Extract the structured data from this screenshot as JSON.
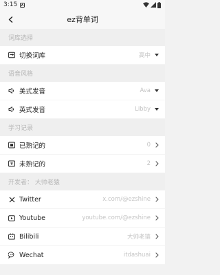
{
  "status_bar": {
    "time": "3:15"
  },
  "header": {
    "title": "ez背单词"
  },
  "sections": {
    "library": {
      "title": "词库选择",
      "switch": {
        "label": "切换词库",
        "value": "高中"
      }
    },
    "voice": {
      "title": "语音风格",
      "us": {
        "label": "美式发音",
        "value": "Ava"
      },
      "uk": {
        "label": "英式发音",
        "value": "Libby"
      }
    },
    "study": {
      "title": "学习记录",
      "known": {
        "label": "已熟记的",
        "value": "0"
      },
      "unknown": {
        "label": "未熟记的",
        "value": "2"
      }
    },
    "developer": {
      "title": "开发者： 大帅老猿",
      "twitter": {
        "label": "Twitter",
        "value": "x.com/@ezshine"
      },
      "youtube": {
        "label": "Youtube",
        "value": "youtube.com/@ezshine"
      },
      "bilibili": {
        "label": "Bilibili",
        "value": "大帅老猿"
      },
      "wechat": {
        "label": "Wechat",
        "value": "itdashuai"
      }
    }
  },
  "colors": {
    "background": "#f2f2f2",
    "row_bg": "#ffffff",
    "muted_text": "#c4c4c4"
  }
}
